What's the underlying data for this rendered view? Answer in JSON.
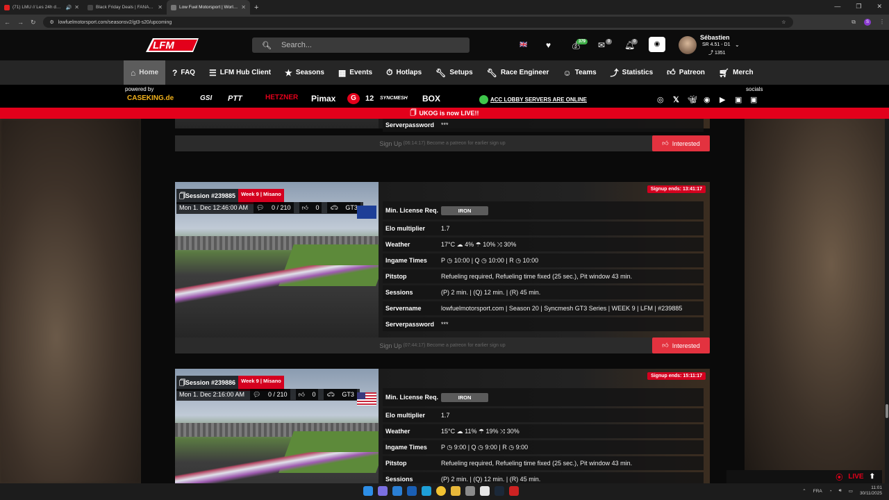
{
  "browser": {
    "tabs": [
      {
        "title": "(71) LMU // Les 24h du Mans",
        "color": "#e02020",
        "active": false
      },
      {
        "title": "Black Friday Deals | FANATEC",
        "color": "#222222",
        "active": false
      },
      {
        "title": "Low Fuel Motorsport | Worlds L",
        "color": "#555555",
        "active": true
      }
    ],
    "url": "lowfuelmotorsport.com/seasonsv2/gt3-s20/upcoming"
  },
  "header": {
    "search_placeholder": "Search...",
    "badges": {
      "coins": "379",
      "messages": "0",
      "notifications": "0"
    },
    "user": {
      "name": "Sébastien",
      "rating": "SR 4.51 - D1",
      "elo": "1351"
    }
  },
  "nav": [
    {
      "label": "Home",
      "icon": "home-icon",
      "active": true
    },
    {
      "label": "FAQ",
      "icon": "question-icon",
      "active": false
    },
    {
      "label": "LFM Hub Client",
      "icon": "list-icon",
      "active": false
    },
    {
      "label": "Seasons",
      "icon": "star-icon",
      "active": false
    },
    {
      "label": "Events",
      "icon": "calendar-icon",
      "active": false
    },
    {
      "label": "Hotlaps",
      "icon": "stopwatch-icon",
      "active": false
    },
    {
      "label": "Setups",
      "icon": "wrench-icon",
      "active": false
    },
    {
      "label": "Race Engineer",
      "icon": "wrench-icon",
      "active": false
    },
    {
      "label": "Teams",
      "icon": "team-icon",
      "active": false
    },
    {
      "label": "Statistics",
      "icon": "chart-icon",
      "active": false
    },
    {
      "label": "Patreon",
      "icon": "thumbs-up-icon",
      "active": false
    },
    {
      "label": "Merch",
      "icon": "cart-icon",
      "active": false
    }
  ],
  "sponsors": {
    "powered_by": "powered by",
    "items": [
      "CASEKING.de",
      "GSI",
      "PTT",
      "HETZNER",
      "Pimax",
      "G",
      "12",
      "SYNCMESH",
      "BOX"
    ],
    "servers_status": "ACC LOBBY SERVERS ARE ONLINE",
    "socials_label": "socials"
  },
  "announcement": "UKOG is now LIVE!!",
  "prev_card": {
    "serverpassword_label": "Serverpassword",
    "serverpassword_value": "***",
    "signup_label": "Sign Up",
    "signup_time": "(06:14:17)",
    "signup_note": "Become a patreon for earlier sign up",
    "interested": "Interested"
  },
  "sessions": [
    {
      "id": "Session #239885",
      "week": "Week 9 | Misano",
      "date": "Mon 1. Dec 12:46:00 AM",
      "drivers": "0 / 210",
      "likes": "0",
      "class": "GT3",
      "flag": "eu",
      "signup_ends": "Signup ends: 13:41:17",
      "rows": [
        {
          "k": "Min. License Req.",
          "v": "IRON"
        },
        {
          "k": "Elo multiplier",
          "v": "1.7"
        },
        {
          "k": "Weather",
          "v": "17°C  ☁ 4%  ☂ 10%  ⤨ 30%"
        },
        {
          "k": "Ingame Times",
          "v": "P ◷ 10:00 | Q ◷ 10:00 | R ◷ 10:00"
        },
        {
          "k": "Pitstop",
          "v": "Refueling required, Refueling time fixed (25 sec.), Pit window 43 min."
        },
        {
          "k": "Sessions",
          "v": "(P) 2 min. | (Q) 12 min. | (R) 45 min."
        },
        {
          "k": "Servername",
          "v": "lowfuelmotorsport.com | Season 20 | Syncmesh GT3 Series | WEEK 9 | LFM | #239885"
        },
        {
          "k": "Serverpassword",
          "v": "***"
        }
      ],
      "signup_label": "Sign Up",
      "signup_time": "(07:44:17)",
      "signup_note": "Become a patreon for earlier sign up",
      "interested": "Interested"
    },
    {
      "id": "Session #239886",
      "week": "Week 9 | Misano",
      "date": "Mon 1. Dec 2:16:00 AM",
      "drivers": "0 / 210",
      "likes": "0",
      "class": "GT3",
      "flag": "us",
      "signup_ends": "Signup ends: 15:11:17",
      "rows": [
        {
          "k": "Min. License Req.",
          "v": "IRON"
        },
        {
          "k": "Elo multiplier",
          "v": "1.7"
        },
        {
          "k": "Weather",
          "v": "15°C  ☁ 11%  ☂ 19%  ⤨ 30%"
        },
        {
          "k": "Ingame Times",
          "v": "P ◷ 9:00 | Q ◷ 9:00 | R ◷ 9:00"
        },
        {
          "k": "Pitstop",
          "v": "Refueling required, Refueling time fixed (25 sec.), Pit window 43 min."
        },
        {
          "k": "Sessions",
          "v": "(P) 2 min. | (Q) 12 min. | (R) 45 min."
        }
      ]
    }
  ],
  "live_label": "LIVE",
  "taskbar": {
    "lang": "FRA",
    "time": "11:01",
    "date": "30/11/2025"
  }
}
